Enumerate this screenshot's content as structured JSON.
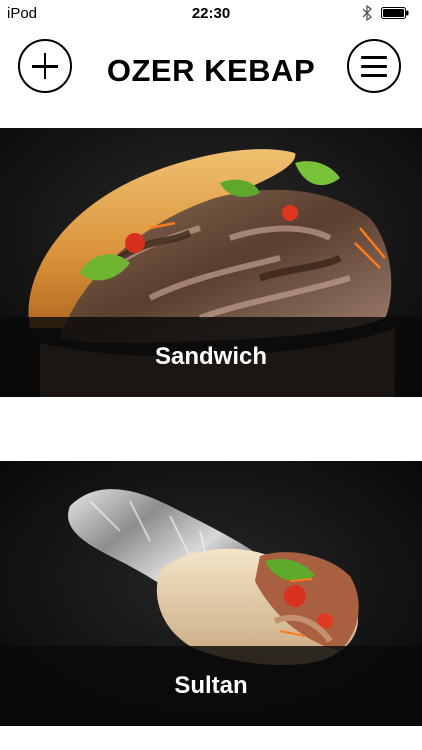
{
  "status_bar": {
    "carrier": "iPod",
    "time": "22:30",
    "bluetooth_icon": "bluetooth-icon",
    "battery_icon": "battery-icon"
  },
  "header": {
    "title": "OZER KEBAP",
    "add_icon": "plus-icon",
    "menu_icon": "hamburger-menu-icon"
  },
  "menu_items": [
    {
      "label": "Sandwich",
      "image": "doner-sandwich-photo"
    },
    {
      "label": "Sultan",
      "image": "doner-wrap-in-foil-photo"
    }
  ],
  "colors": {
    "background": "#ffffff",
    "card_background": "#000000",
    "caption_text": "#ffffff"
  }
}
